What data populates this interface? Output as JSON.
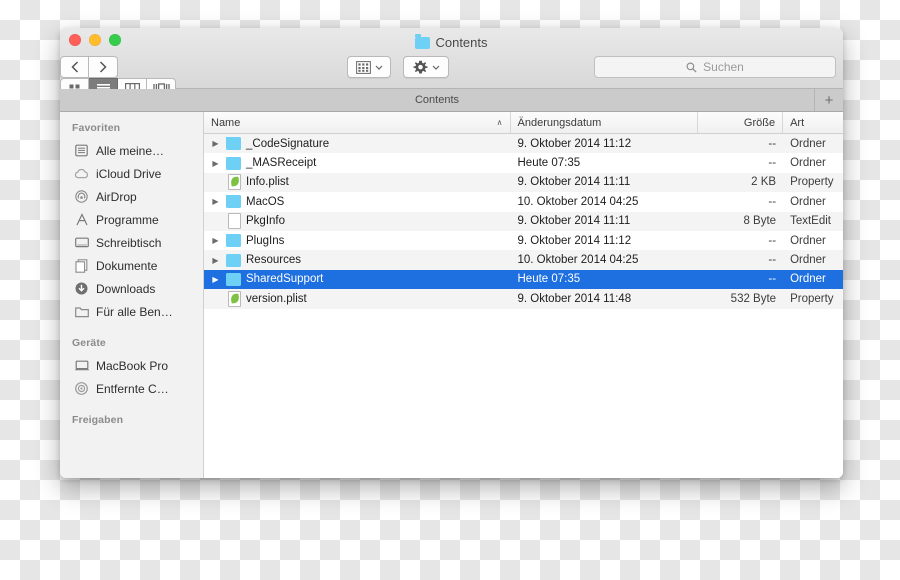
{
  "window": {
    "title": "Contents",
    "title_icon": "folder-icon",
    "traffic_lights": [
      {
        "name": "close",
        "color": "#ff5f57"
      },
      {
        "name": "minimize",
        "color": "#ffbd2e"
      },
      {
        "name": "maximize",
        "color": "#35cd4b"
      }
    ]
  },
  "toolbar": {
    "back_label": "‹",
    "forward_label": "›",
    "view_modes": [
      {
        "name": "icon-view",
        "active": false
      },
      {
        "name": "list-view",
        "active": true
      },
      {
        "name": "column-view",
        "active": false
      },
      {
        "name": "gallery-view",
        "active": false
      }
    ],
    "arrange_label": "arrange-icon",
    "action_label": "gear-icon",
    "share_label": "share-icon",
    "tag_label": "tag-icon",
    "chevron": "⌄"
  },
  "search": {
    "placeholder": "Suchen",
    "value": "",
    "icon": "search-icon"
  },
  "tabbar": {
    "tabs": [
      {
        "label": "Contents",
        "active": true
      }
    ],
    "add_label": "+"
  },
  "sidebar": {
    "sections": [
      {
        "header": "Favoriten",
        "items": [
          {
            "label": "Alle meine…",
            "icon": "all-my-files-icon"
          },
          {
            "label": "iCloud Drive",
            "icon": "cloud-icon"
          },
          {
            "label": "AirDrop",
            "icon": "airdrop-icon"
          },
          {
            "label": "Programme",
            "icon": "applications-icon"
          },
          {
            "label": "Schreibtisch",
            "icon": "desktop-icon"
          },
          {
            "label": "Dokumente",
            "icon": "documents-icon"
          },
          {
            "label": "Downloads",
            "icon": "downloads-icon"
          },
          {
            "label": "Für alle Ben…",
            "icon": "folder-icon"
          }
        ]
      },
      {
        "header": "Geräte",
        "items": [
          {
            "label": "MacBook Pro",
            "icon": "laptop-icon"
          },
          {
            "label": "Entfernte C…",
            "icon": "disc-icon"
          }
        ]
      },
      {
        "header": "Freigaben",
        "items": []
      }
    ]
  },
  "filelist": {
    "columns": [
      {
        "key": "name",
        "label": "Name",
        "sorted": true,
        "sort_arrow": "∧"
      },
      {
        "key": "date",
        "label": "Änderungsdatum"
      },
      {
        "key": "size",
        "label": "Größe"
      },
      {
        "key": "kind",
        "label": "Art"
      }
    ],
    "rows": [
      {
        "name": "_CodeSignature",
        "date": "9. Oktober 2014 11:12",
        "size": "--",
        "kind": "Ordner",
        "icon": "folder-icon",
        "expandable": true,
        "selected": false
      },
      {
        "name": "_MASReceipt",
        "date": "Heute 07:35",
        "size": "--",
        "kind": "Ordner",
        "icon": "folder-icon",
        "expandable": true,
        "selected": false
      },
      {
        "name": "Info.plist",
        "date": "9. Oktober 2014 11:11",
        "size": "2 KB",
        "kind": "Property",
        "icon": "plist-icon",
        "expandable": false,
        "selected": false
      },
      {
        "name": "MacOS",
        "date": "10. Oktober 2014 04:25",
        "size": "--",
        "kind": "Ordner",
        "icon": "folder-icon",
        "expandable": true,
        "selected": false
      },
      {
        "name": "PkgInfo",
        "date": "9. Oktober 2014 11:11",
        "size": "8 Byte",
        "kind": "TextEdit",
        "icon": "doc-icon",
        "expandable": false,
        "selected": false
      },
      {
        "name": "PlugIns",
        "date": "9. Oktober 2014 11:12",
        "size": "--",
        "kind": "Ordner",
        "icon": "folder-icon",
        "expandable": true,
        "selected": false
      },
      {
        "name": "Resources",
        "date": "10. Oktober 2014 04:25",
        "size": "--",
        "kind": "Ordner",
        "icon": "folder-icon",
        "expandable": true,
        "selected": false
      },
      {
        "name": "SharedSupport",
        "date": "Heute 07:35",
        "size": "--",
        "kind": "Ordner",
        "icon": "folder-icon",
        "expandable": true,
        "selected": true
      },
      {
        "name": "version.plist",
        "date": "9. Oktober 2014 11:48",
        "size": "532 Byte",
        "kind": "Property",
        "icon": "plist-icon",
        "expandable": false,
        "selected": false
      }
    ]
  },
  "colors": {
    "selection": "#1e6fe0",
    "folder": "#6fd0f5",
    "tabbar": "#cbcbcb"
  }
}
